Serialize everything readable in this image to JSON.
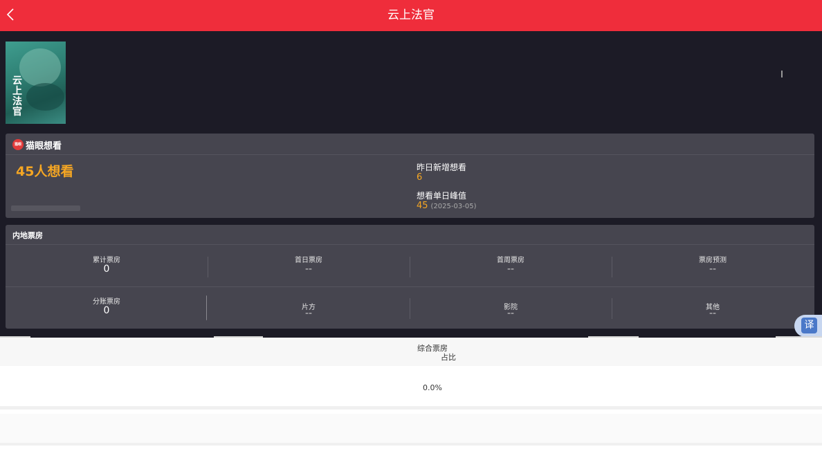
{
  "header": {
    "title": "云上法官",
    "back_icon": "back-chevron-icon"
  },
  "poster": {
    "title_text": "云上法官"
  },
  "want_card": {
    "title": "猫眼想看",
    "logo_text": "猫眼",
    "total": "45人想看",
    "yesterday_label": "昨日新增想看",
    "yesterday_value": "6",
    "peak_label": "想看单日峰值",
    "peak_value": "45",
    "peak_date": "(2025-03-05)"
  },
  "box_office": {
    "title": "内地票房",
    "row1": [
      {
        "label": "累计票房",
        "value": "0"
      },
      {
        "label": "首日票房",
        "value": "--"
      },
      {
        "label": "首周票房",
        "value": "--"
      },
      {
        "label": "票房预测",
        "value": "--"
      }
    ],
    "row2": [
      {
        "label": "分账票房",
        "value": "0"
      },
      {
        "label": "片方",
        "value": "--"
      },
      {
        "label": "影院",
        "value": "--"
      },
      {
        "label": "其他",
        "value": "--"
      }
    ]
  },
  "translate": {
    "label": "译"
  },
  "table": {
    "header_line1": "综合票房",
    "header_line2": "占比",
    "row_value": "0.0%"
  },
  "colors": {
    "topbar": "#ef2d3b",
    "accent": "#f5a623",
    "card": "#46454f",
    "background": "#1c1b26"
  }
}
